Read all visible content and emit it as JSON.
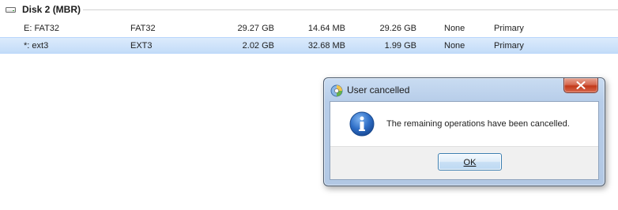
{
  "disk": {
    "title": "Disk 2 (MBR)",
    "icon": "drive-icon"
  },
  "partitions": [
    {
      "name": "E: FAT32",
      "filesystem": "FAT32",
      "capacity": "29.27 GB",
      "used": "14.64 MB",
      "unused": "29.26 GB",
      "flags": "None",
      "status": "Primary",
      "selected": false
    },
    {
      "name": "*: ext3",
      "filesystem": "EXT3",
      "capacity": "2.02 GB",
      "used": "32.68 MB",
      "unused": "1.99 GB",
      "flags": "None",
      "status": "Primary",
      "selected": true
    }
  ],
  "dialog": {
    "title": "User cancelled",
    "title_icon": "app-icon",
    "message": "The remaining operations have been cancelled.",
    "message_icon": "info-icon",
    "ok_label": "OK",
    "close_icon": "close-icon"
  },
  "colors": {
    "selection": "#c3dcf8",
    "dialog_frame": "#b7cde9",
    "close_button": "#c2391a",
    "info_icon": "#1f5fb5"
  }
}
